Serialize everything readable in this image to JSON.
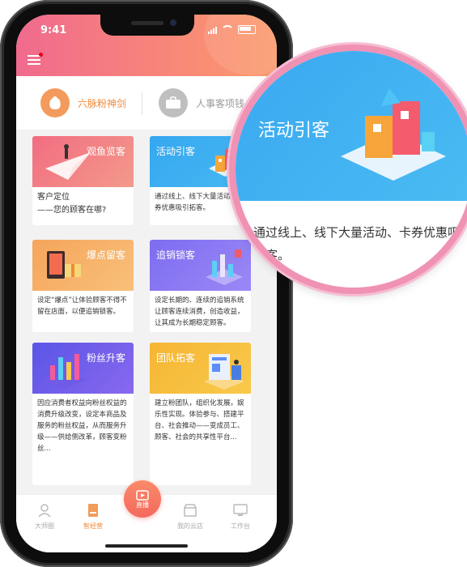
{
  "status": {
    "time": "9:41"
  },
  "tabs": [
    {
      "label": "六脉粉神剑"
    },
    {
      "label": "人事客项钱"
    }
  ],
  "cards": [
    {
      "title": "观鱼览客",
      "desc": "客户定位\n——您的顾客在哪?"
    },
    {
      "title": "活动引客",
      "desc": "通过线上、线下大量活动、卡券优惠吸引拓客。"
    },
    {
      "title": "爆点留客",
      "desc": "设定“爆点”让体验顾客不得不留在店面，以便追销锁客。"
    },
    {
      "title": "追销锁客",
      "desc": "设定长期的、连续的追销系统让顾客连续消费，创造收益，让其成为长期稳定顾客。"
    },
    {
      "title": "粉丝升客",
      "desc": "因应消费者权益向粉丝权益的消费升级改变，设定本商品及服务的粉丝权益，从而服务升级——供给侧改革，顾客变粉丝..."
    },
    {
      "title": "团队拓客",
      "desc": "建立粉团队，组织化发展，娱乐性实现。体验参与、搭建平台、社会推动——变成员工、顾客、社会的共享性平台..."
    }
  ],
  "nav": [
    {
      "label": "大师圈"
    },
    {
      "label": "智经营"
    },
    {
      "label": "直播"
    },
    {
      "label": "我的云店"
    },
    {
      "label": "工作台"
    }
  ],
  "magnifier": {
    "title": "活动引客",
    "desc": "通过线上、线下大量活动、卡券优惠吸引拓客。"
  }
}
